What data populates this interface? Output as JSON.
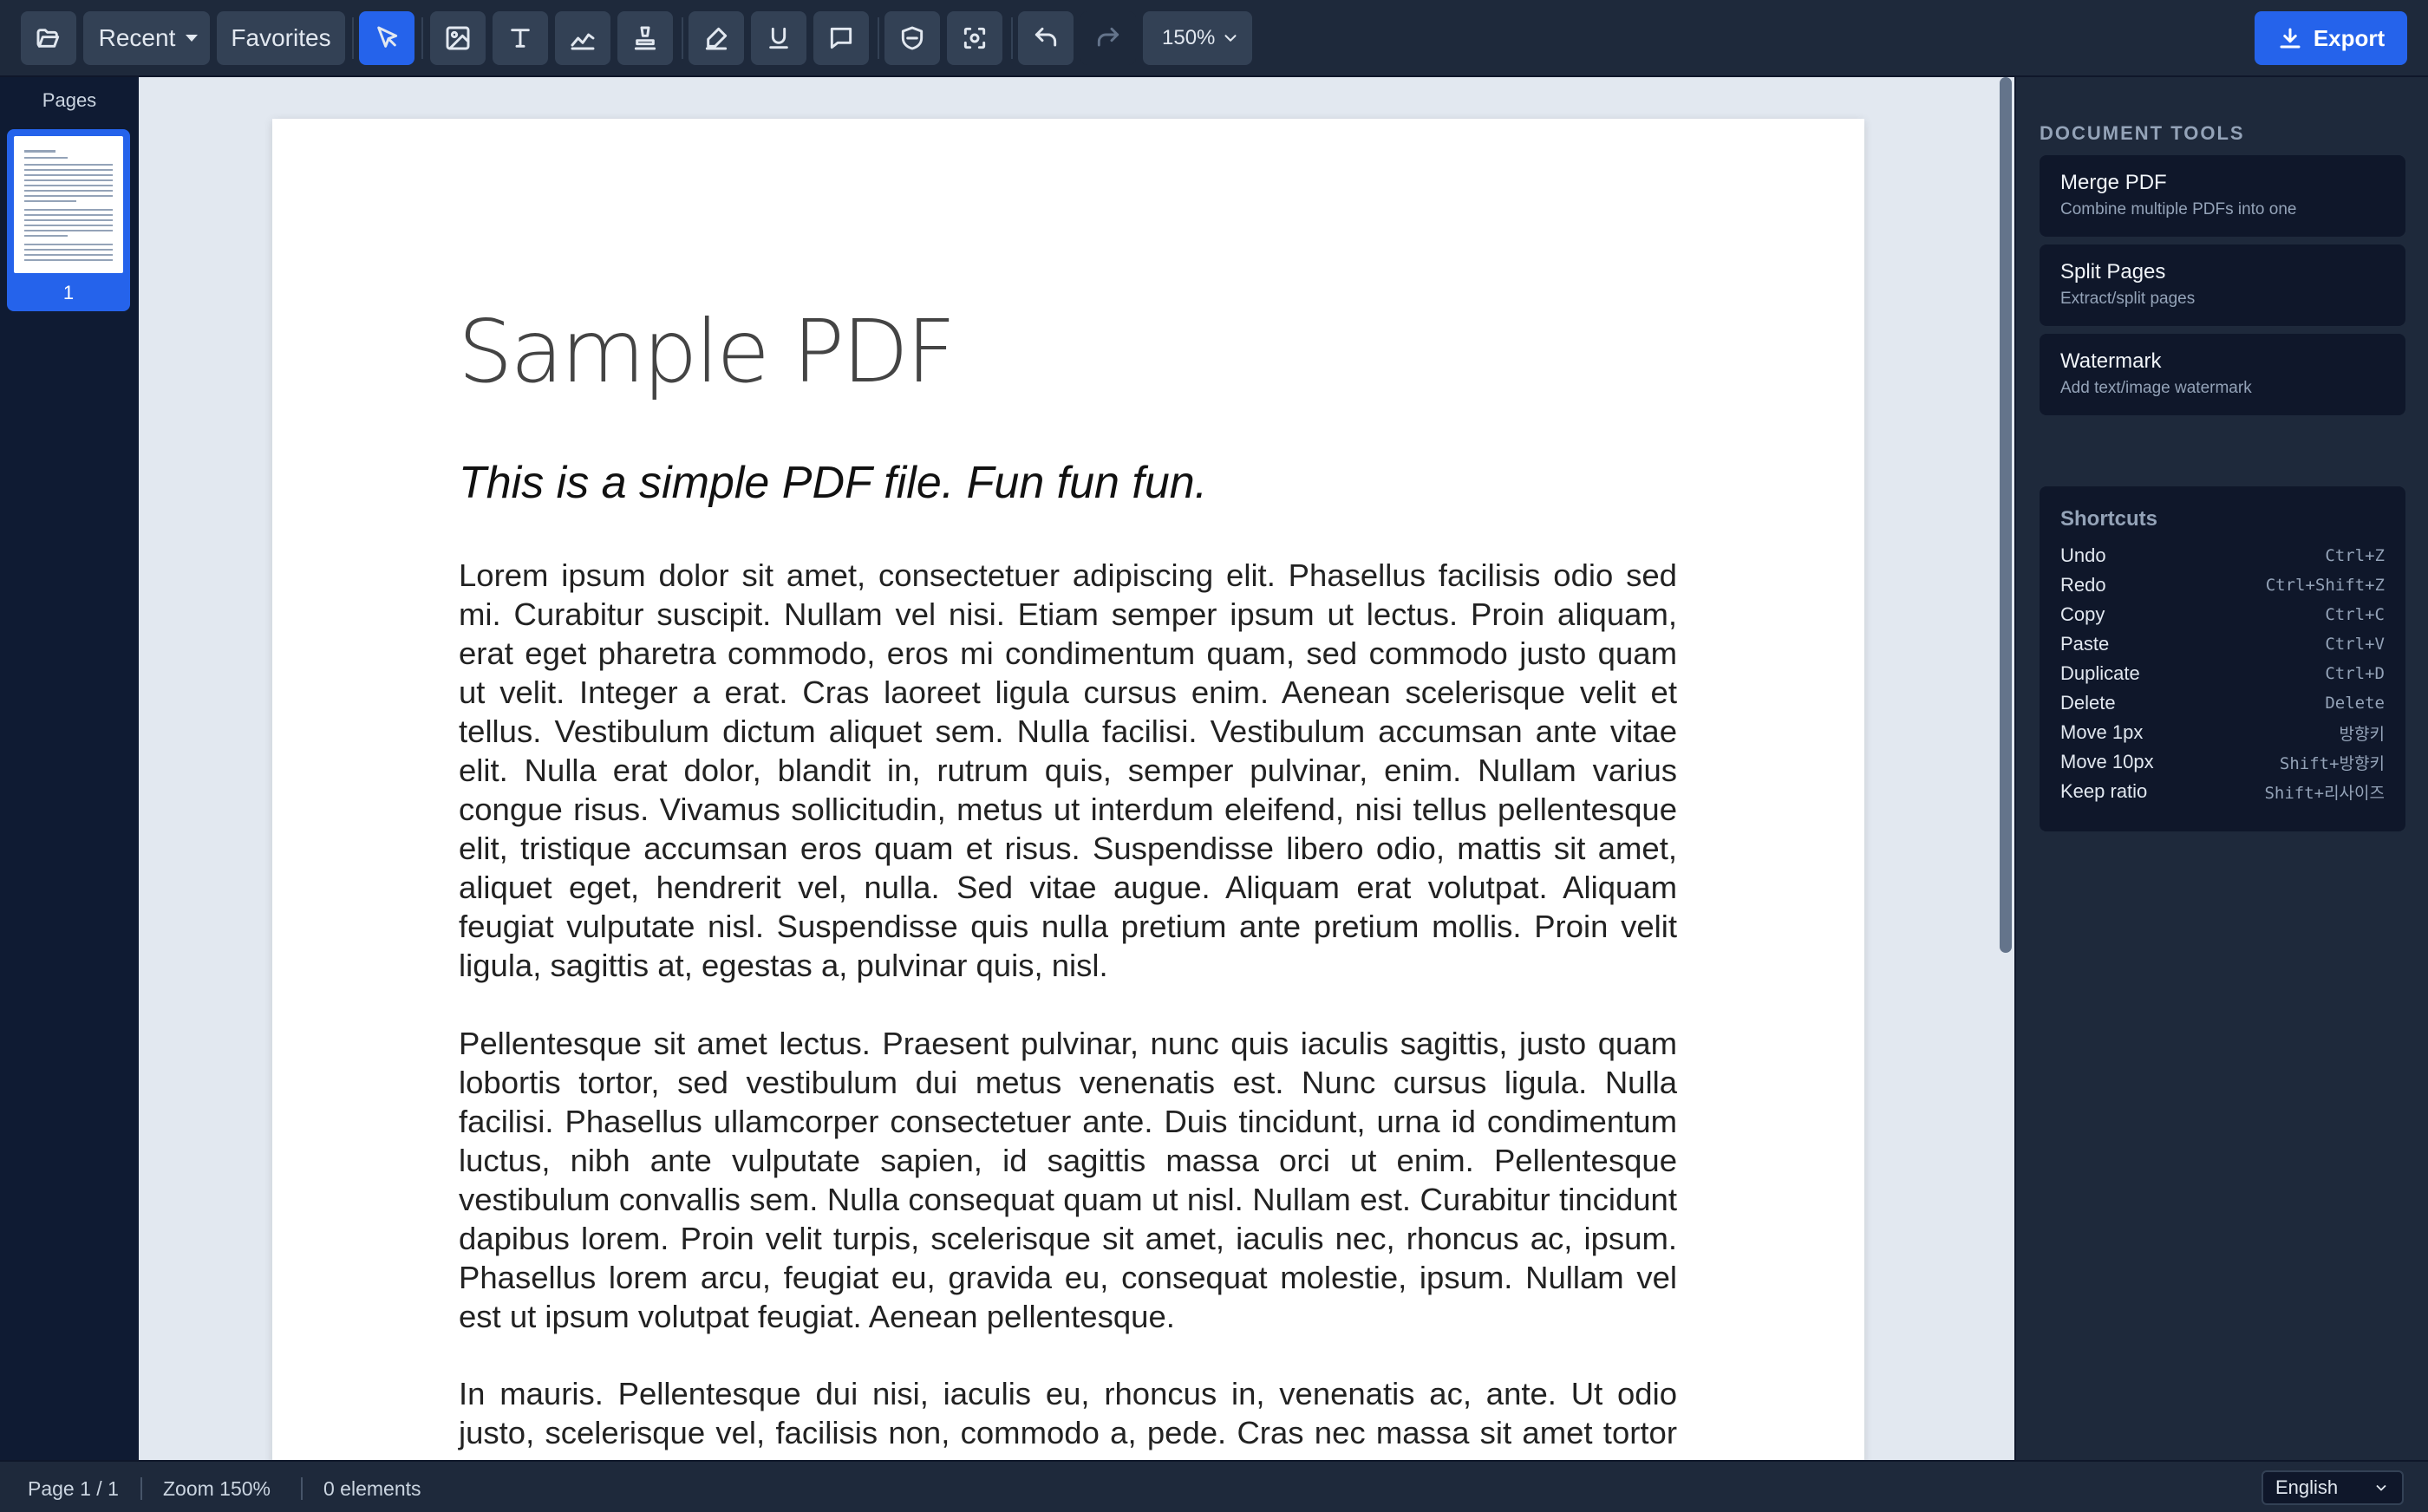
{
  "toolbar": {
    "recent_label": "Recent",
    "favorites_label": "Favorites",
    "zoom_value": "150%",
    "export_label": "Export",
    "icons": [
      "folder-open-icon",
      "pointer-icon",
      "image-icon",
      "text-icon",
      "draw-icon",
      "stamp-icon",
      "highlighter-icon",
      "underline-icon",
      "comment-icon",
      "redact-shield-icon",
      "scan-icon",
      "undo-icon",
      "redo-icon"
    ]
  },
  "pages_panel": {
    "title": "Pages",
    "thumbnails": [
      {
        "number": "1"
      }
    ]
  },
  "document": {
    "title": "Sample PDF",
    "subtitle": "This is a simple PDF file. Fun fun fun.",
    "paragraphs": [
      "Lorem ipsum dolor sit amet, consectetuer adipiscing elit. Phasellus facilisis odio sed mi. Curabitur suscipit. Nullam vel nisi. Etiam semper ipsum ut lectus. Proin aliquam, erat eget pharetra commodo, eros mi condimentum quam, sed commodo justo quam ut velit. Integer a erat. Cras laoreet ligula cursus enim. Aenean scelerisque velit et tellus. Vestibulum dictum aliquet sem. Nulla facilisi. Vestibulum accumsan ante vitae elit. Nulla erat dolor, blandit in, rutrum quis, semper pulvinar, enim. Nullam varius congue risus. Vivamus sollicitudin, metus ut interdum eleifend, nisi tellus pellentesque elit, tristique accumsan eros quam et risus. Suspendisse libero odio, mattis sit amet, aliquet eget, hendrerit vel, nulla. Sed vitae augue. Aliquam erat volutpat. Aliquam feugiat vulputate nisl. Suspendisse quis nulla pretium ante pretium mollis. Proin velit ligula, sagittis at, egestas a, pulvinar quis, nisl.",
      "Pellentesque sit amet lectus. Praesent pulvinar, nunc quis iaculis sagittis, justo quam lobortis tortor, sed vestibulum dui metus venenatis est. Nunc cursus ligula. Nulla facilisi. Phasellus ullamcorper consectetuer ante. Duis tincidunt, urna id condimentum luctus, nibh ante vulputate sapien, id sagittis massa orci ut enim. Pellentesque vestibulum convallis sem. Nulla consequat quam ut nisl. Nullam est. Curabitur tincidunt dapibus lorem. Proin velit turpis, scelerisque sit amet, iaculis nec, rhoncus ac, ipsum. Phasellus lorem arcu, feugiat eu, gravida eu, consequat molestie, ipsum. Nullam vel est ut ipsum volutpat feugiat. Aenean pellentesque.",
      "In mauris. Pellentesque dui nisi, iaculis eu, rhoncus in, venenatis ac, ante. Ut odio justo, scelerisque vel, facilisis non, commodo a, pede. Cras nec massa sit amet tortor volutpat varius. Donec lacinia, neque a luctus aliquet, pede massa imperdiet ante, at varius lorem"
    ]
  },
  "right_panel": {
    "section_title": "DOCUMENT TOOLS",
    "tools": [
      {
        "name": "Merge PDF",
        "desc": "Combine multiple PDFs into one"
      },
      {
        "name": "Split Pages",
        "desc": "Extract/split pages"
      },
      {
        "name": "Watermark",
        "desc": "Add text/image watermark"
      }
    ],
    "shortcuts_title": "Shortcuts",
    "shortcuts": [
      {
        "label": "Undo",
        "key": "Ctrl+Z"
      },
      {
        "label": "Redo",
        "key": "Ctrl+Shift+Z"
      },
      {
        "label": "Copy",
        "key": "Ctrl+C"
      },
      {
        "label": "Paste",
        "key": "Ctrl+V"
      },
      {
        "label": "Duplicate",
        "key": "Ctrl+D"
      },
      {
        "label": "Delete",
        "key": "Delete"
      },
      {
        "label": "Move 1px",
        "key": "방향키"
      },
      {
        "label": "Move 10px",
        "key": "Shift+방향키"
      },
      {
        "label": "Keep ratio",
        "key": "Shift+리사이즈"
      }
    ]
  },
  "status": {
    "page": "Page 1 / 1",
    "zoom": "Zoom 150%",
    "elements": "0 elements",
    "language": "English"
  },
  "colors": {
    "accent": "#2563eb",
    "toolbar_bg": "#1e293b",
    "panel_bg": "#0f172a",
    "canvas_bg": "#e2e8f0"
  }
}
